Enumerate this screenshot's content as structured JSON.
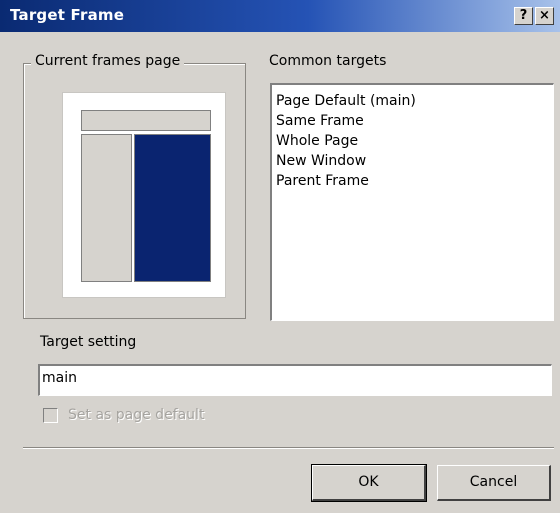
{
  "window": {
    "title": "Target Frame",
    "help_button": "?",
    "close_button": "×"
  },
  "current_frames": {
    "label": "Current frames page"
  },
  "common_targets": {
    "label": "Common targets",
    "items": [
      "Page Default (main)",
      "Same Frame",
      "Whole Page",
      "New Window",
      "Parent Frame"
    ]
  },
  "target_setting": {
    "label": "Target setting",
    "value": "main"
  },
  "set_default": {
    "label": "Set as page default",
    "checked": false,
    "enabled": false
  },
  "buttons": {
    "ok": "OK",
    "cancel": "Cancel"
  },
  "colors": {
    "title_bar_start": "#0a2a72",
    "selected_frame": "#0a2470",
    "dialog_face": "#d6d3ce"
  }
}
